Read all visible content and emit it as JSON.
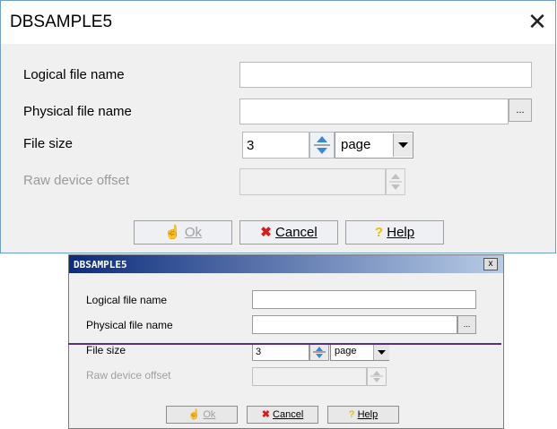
{
  "dialog_top": {
    "title": "DBSAMPLE5",
    "logical_label": "Logical file name",
    "physical_label": "Physical file name",
    "filesize_label": "File size",
    "rawdevice_label": "Raw device offset",
    "ellipsis": "...",
    "filesize_value": "3",
    "unit_value": "page",
    "ok_label": "Ok",
    "cancel_label": "Cancel",
    "help_label": "Help"
  },
  "dialog_bottom": {
    "title": "DBSAMPLE5",
    "close": "x",
    "logical_label": "Logical file name",
    "physical_label": "Physical file name",
    "filesize_label": "File size",
    "rawdevice_label": "Raw device offset",
    "ellipsis": "...",
    "filesize_value": "3",
    "unit_value": "page",
    "ok_label": "Ok",
    "cancel_label": "Cancel",
    "help_label": "Help"
  },
  "icons": {
    "close": "close-icon",
    "ok": "hand-icon",
    "cancel": "x-mark-icon",
    "help": "question-icon",
    "spin": "spinner-icon",
    "dropdown": "dropdown-arrow-icon"
  },
  "colors": {
    "cancel_red": "#d81c1c",
    "help_yellow": "#f0d000",
    "title_blue": "#0c2c7c"
  }
}
